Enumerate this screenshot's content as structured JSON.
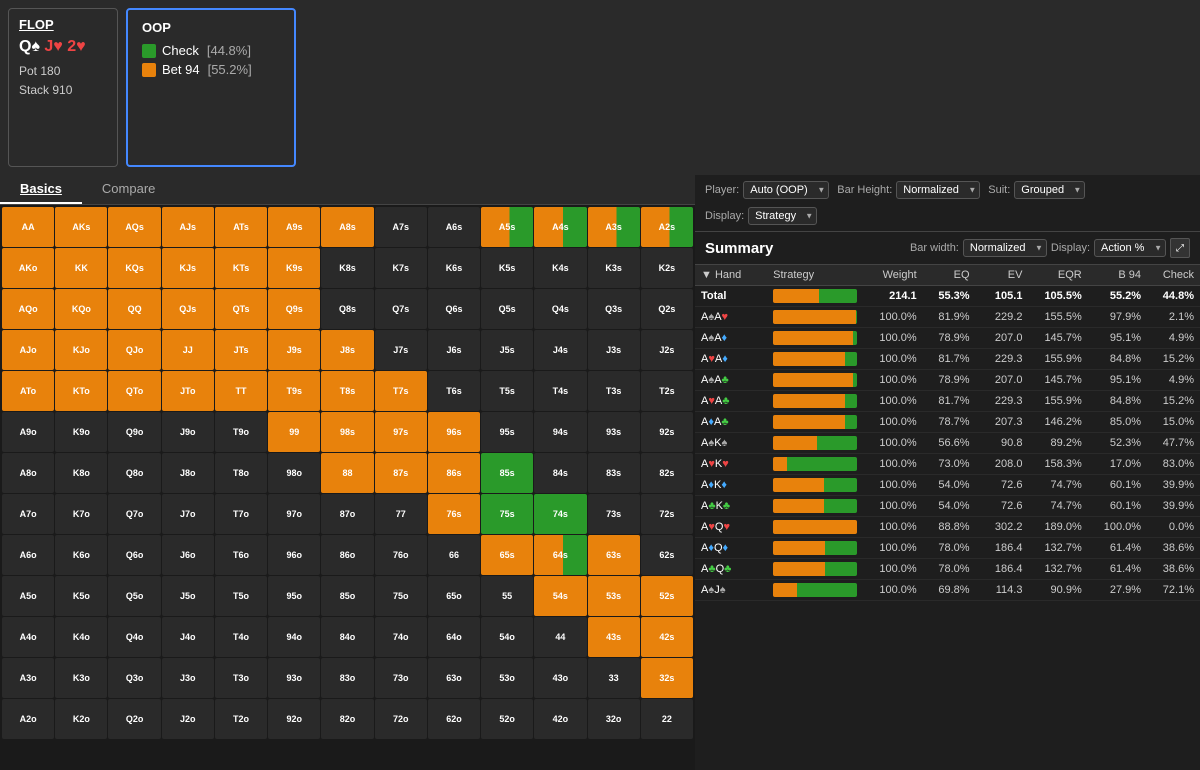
{
  "flop": {
    "title": "FLOP",
    "cards": "Q♠ J♥ 2♥",
    "pot": "Pot 180",
    "stack": "Stack 910"
  },
  "oop": {
    "title": "OOP",
    "actions": [
      {
        "label": "Check",
        "pct": "[44.8%]",
        "color": "#2a9a2a"
      },
      {
        "label": "Bet 94",
        "pct": "[55.2%]",
        "color": "#e8820c"
      }
    ]
  },
  "tabs": [
    {
      "label": "Basics",
      "active": true
    },
    {
      "label": "Compare",
      "active": false
    }
  ],
  "controls": {
    "player_label": "Player:",
    "player_value": "Auto (OOP)",
    "bar_height_label": "Bar Height:",
    "bar_height_value": "Normalized",
    "suit_label": "Suit:",
    "suit_value": "Grouped",
    "display_label": "Display:",
    "display_value": "Strategy",
    "bar_width_label": "Bar width:",
    "bar_width_value": "Normalized",
    "display2_label": "Display:",
    "display2_value": "Action %"
  },
  "summary": {
    "title": "Summary",
    "columns": [
      "Hand",
      "Strategy",
      "Weight",
      "EQ",
      "EV",
      "EQR",
      "B 94",
      "Check"
    ],
    "total": {
      "hand": "Total",
      "weight": "214.1",
      "eq": "55.3%",
      "ev": "105.1",
      "eqr": "105.5%",
      "b94": "55.2%",
      "check": "44.8%",
      "bar": [
        55,
        45
      ]
    },
    "rows": [
      {
        "hand": "A♠A♥",
        "hand_html": "A♠A♥",
        "weight": "100.0%",
        "eq": "81.9%",
        "ev": "229.2",
        "eqr": "155.5%",
        "b94": "97.9%",
        "check": "2.1%",
        "bar": [
          98,
          2
        ]
      },
      {
        "hand": "A♠A♦",
        "hand_html": "A♠A♦",
        "weight": "100.0%",
        "eq": "78.9%",
        "ev": "207.0",
        "eqr": "145.7%",
        "b94": "95.1%",
        "check": "4.9%",
        "bar": [
          95,
          5
        ]
      },
      {
        "hand": "A♥A♦",
        "hand_html": "A♥A♦",
        "weight": "100.0%",
        "eq": "81.7%",
        "ev": "229.3",
        "eqr": "155.9%",
        "b94": "84.8%",
        "check": "15.2%",
        "bar": [
          85,
          15
        ]
      },
      {
        "hand": "A♠A♣",
        "hand_html": "A♠A♣",
        "weight": "100.0%",
        "eq": "78.9%",
        "ev": "207.0",
        "eqr": "145.7%",
        "b94": "95.1%",
        "check": "4.9%",
        "bar": [
          95,
          5
        ]
      },
      {
        "hand": "A♥A♣",
        "hand_html": "A♥A♣",
        "weight": "100.0%",
        "eq": "81.7%",
        "ev": "229.3",
        "eqr": "155.9%",
        "b94": "84.8%",
        "check": "15.2%",
        "bar": [
          85,
          15
        ]
      },
      {
        "hand": "A♦A♣",
        "hand_html": "A♦A♣",
        "weight": "100.0%",
        "eq": "78.7%",
        "ev": "207.3",
        "eqr": "146.2%",
        "b94": "85.0%",
        "check": "15.0%",
        "bar": [
          85,
          15
        ]
      },
      {
        "hand": "A♠K♠",
        "hand_html": "A♠K♠",
        "weight": "100.0%",
        "eq": "56.6%",
        "ev": "90.8",
        "eqr": "89.2%",
        "b94": "52.3%",
        "check": "47.7%",
        "bar": [
          52,
          48
        ]
      },
      {
        "hand": "A♥K♥",
        "hand_html": "A♥K♥",
        "weight": "100.0%",
        "eq": "73.0%",
        "ev": "208.0",
        "eqr": "158.3%",
        "b94": "17.0%",
        "check": "83.0%",
        "bar": [
          17,
          83
        ]
      },
      {
        "hand": "A♦K♦",
        "hand_html": "A♦K♦",
        "weight": "100.0%",
        "eq": "54.0%",
        "ev": "72.6",
        "eqr": "74.7%",
        "b94": "60.1%",
        "check": "39.9%",
        "bar": [
          60,
          40
        ]
      },
      {
        "hand": "A♣K♣",
        "hand_html": "A♣K♣",
        "weight": "100.0%",
        "eq": "54.0%",
        "ev": "72.6",
        "eqr": "74.7%",
        "b94": "60.1%",
        "check": "39.9%",
        "bar": [
          60,
          40
        ]
      },
      {
        "hand": "A♥Q♥",
        "hand_html": "A♥Q♥",
        "weight": "100.0%",
        "eq": "88.8%",
        "ev": "302.2",
        "eqr": "189.0%",
        "b94": "100.0%",
        "check": "0.0%",
        "bar": [
          100,
          0
        ]
      },
      {
        "hand": "A♦Q♦",
        "hand_html": "A♦Q♦",
        "weight": "100.0%",
        "eq": "78.0%",
        "ev": "186.4",
        "eqr": "132.7%",
        "b94": "61.4%",
        "check": "38.6%",
        "bar": [
          61,
          39
        ]
      },
      {
        "hand": "A♣Q♣",
        "hand_html": "A♣Q♣",
        "weight": "100.0%",
        "eq": "78.0%",
        "ev": "186.4",
        "eqr": "132.7%",
        "b94": "61.4%",
        "check": "38.6%",
        "bar": [
          61,
          39
        ]
      },
      {
        "hand": "A♠J♠",
        "hand_html": "A♠J♠",
        "weight": "100.0%",
        "eq": "69.8%",
        "ev": "114.3",
        "eqr": "90.9%",
        "b94": "27.9%",
        "check": "72.1%",
        "bar": [
          28,
          72
        ]
      }
    ]
  },
  "grid": {
    "cells": [
      {
        "label": "AA",
        "type": "orange"
      },
      {
        "label": "AKs",
        "type": "orange"
      },
      {
        "label": "AQs",
        "type": "orange"
      },
      {
        "label": "AJs",
        "type": "orange"
      },
      {
        "label": "ATs",
        "type": "orange"
      },
      {
        "label": "A9s",
        "type": "orange"
      },
      {
        "label": "A8s",
        "type": "orange"
      },
      {
        "label": "A7s",
        "type": "dark"
      },
      {
        "label": "A6s",
        "type": "dark"
      },
      {
        "label": "A5s",
        "type": "mixed"
      },
      {
        "label": "A4s",
        "type": "mixed"
      },
      {
        "label": "A3s",
        "type": "mixed"
      },
      {
        "label": "A2s",
        "type": "mixed"
      },
      {
        "label": "AKo",
        "type": "orange"
      },
      {
        "label": "KK",
        "type": "orange"
      },
      {
        "label": "KQs",
        "type": "orange"
      },
      {
        "label": "KJs",
        "type": "orange"
      },
      {
        "label": "KTs",
        "type": "orange"
      },
      {
        "label": "K9s",
        "type": "orange"
      },
      {
        "label": "K8s",
        "type": "dark"
      },
      {
        "label": "K7s",
        "type": "dark"
      },
      {
        "label": "K6s",
        "type": "dark"
      },
      {
        "label": "K5s",
        "type": "dark"
      },
      {
        "label": "K4s",
        "type": "dark"
      },
      {
        "label": "K3s",
        "type": "dark"
      },
      {
        "label": "K2s",
        "type": "dark"
      },
      {
        "label": "AQo",
        "type": "orange"
      },
      {
        "label": "KQo",
        "type": "orange"
      },
      {
        "label": "QQ",
        "type": "orange"
      },
      {
        "label": "QJs",
        "type": "orange"
      },
      {
        "label": "QTs",
        "type": "orange"
      },
      {
        "label": "Q9s",
        "type": "orange"
      },
      {
        "label": "Q8s",
        "type": "dark"
      },
      {
        "label": "Q7s",
        "type": "dark"
      },
      {
        "label": "Q6s",
        "type": "dark"
      },
      {
        "label": "Q5s",
        "type": "dark"
      },
      {
        "label": "Q4s",
        "type": "dark"
      },
      {
        "label": "Q3s",
        "type": "dark"
      },
      {
        "label": "Q2s",
        "type": "dark"
      },
      {
        "label": "AJo",
        "type": "orange"
      },
      {
        "label": "KJo",
        "type": "orange"
      },
      {
        "label": "QJo",
        "type": "orange"
      },
      {
        "label": "JJ",
        "type": "orange"
      },
      {
        "label": "JTs",
        "type": "orange"
      },
      {
        "label": "J9s",
        "type": "orange"
      },
      {
        "label": "J8s",
        "type": "orange"
      },
      {
        "label": "J7s",
        "type": "dark"
      },
      {
        "label": "J6s",
        "type": "dark"
      },
      {
        "label": "J5s",
        "type": "dark"
      },
      {
        "label": "J4s",
        "type": "dark"
      },
      {
        "label": "J3s",
        "type": "dark"
      },
      {
        "label": "J2s",
        "type": "dark"
      },
      {
        "label": "ATo",
        "type": "orange"
      },
      {
        "label": "KTo",
        "type": "orange"
      },
      {
        "label": "QTo",
        "type": "orange"
      },
      {
        "label": "JTo",
        "type": "orange"
      },
      {
        "label": "TT",
        "type": "orange"
      },
      {
        "label": "T9s",
        "type": "orange"
      },
      {
        "label": "T8s",
        "type": "orange"
      },
      {
        "label": "T7s",
        "type": "orange"
      },
      {
        "label": "T6s",
        "type": "dark"
      },
      {
        "label": "T5s",
        "type": "dark"
      },
      {
        "label": "T4s",
        "type": "dark"
      },
      {
        "label": "T3s",
        "type": "dark"
      },
      {
        "label": "T2s",
        "type": "dark"
      },
      {
        "label": "A9o",
        "type": "dark"
      },
      {
        "label": "K9o",
        "type": "dark"
      },
      {
        "label": "Q9o",
        "type": "dark"
      },
      {
        "label": "J9o",
        "type": "dark"
      },
      {
        "label": "T9o",
        "type": "dark"
      },
      {
        "label": "99",
        "type": "orange"
      },
      {
        "label": "98s",
        "type": "orange"
      },
      {
        "label": "97s",
        "type": "orange"
      },
      {
        "label": "96s",
        "type": "orange"
      },
      {
        "label": "95s",
        "type": "dark"
      },
      {
        "label": "94s",
        "type": "dark"
      },
      {
        "label": "93s",
        "type": "dark"
      },
      {
        "label": "92s",
        "type": "dark"
      },
      {
        "label": "A8o",
        "type": "dark"
      },
      {
        "label": "K8o",
        "type": "dark"
      },
      {
        "label": "Q8o",
        "type": "dark"
      },
      {
        "label": "J8o",
        "type": "dark"
      },
      {
        "label": "T8o",
        "type": "dark"
      },
      {
        "label": "98o",
        "type": "dark"
      },
      {
        "label": "88",
        "type": "orange"
      },
      {
        "label": "87s",
        "type": "orange"
      },
      {
        "label": "86s",
        "type": "orange"
      },
      {
        "label": "85s",
        "type": "green"
      },
      {
        "label": "84s",
        "type": "dark"
      },
      {
        "label": "83s",
        "type": "dark"
      },
      {
        "label": "82s",
        "type": "dark"
      },
      {
        "label": "A7o",
        "type": "dark"
      },
      {
        "label": "K7o",
        "type": "dark"
      },
      {
        "label": "Q7o",
        "type": "dark"
      },
      {
        "label": "J7o",
        "type": "dark"
      },
      {
        "label": "T7o",
        "type": "dark"
      },
      {
        "label": "97o",
        "type": "dark"
      },
      {
        "label": "87o",
        "type": "dark"
      },
      {
        "label": "77",
        "type": "dark"
      },
      {
        "label": "76s",
        "type": "orange"
      },
      {
        "label": "75s",
        "type": "green"
      },
      {
        "label": "74s",
        "type": "green"
      },
      {
        "label": "73s",
        "type": "dark"
      },
      {
        "label": "72s",
        "type": "dark"
      },
      {
        "label": "A6o",
        "type": "dark"
      },
      {
        "label": "K6o",
        "type": "dark"
      },
      {
        "label": "Q6o",
        "type": "dark"
      },
      {
        "label": "J6o",
        "type": "dark"
      },
      {
        "label": "T6o",
        "type": "dark"
      },
      {
        "label": "96o",
        "type": "dark"
      },
      {
        "label": "86o",
        "type": "dark"
      },
      {
        "label": "76o",
        "type": "dark"
      },
      {
        "label": "66",
        "type": "dark"
      },
      {
        "label": "65s",
        "type": "orange"
      },
      {
        "label": "64s",
        "type": "mixed"
      },
      {
        "label": "63s",
        "type": "orange"
      },
      {
        "label": "62s",
        "type": "dark"
      },
      {
        "label": "A5o",
        "type": "dark"
      },
      {
        "label": "K5o",
        "type": "dark"
      },
      {
        "label": "Q5o",
        "type": "dark"
      },
      {
        "label": "J5o",
        "type": "dark"
      },
      {
        "label": "T5o",
        "type": "dark"
      },
      {
        "label": "95o",
        "type": "dark"
      },
      {
        "label": "85o",
        "type": "dark"
      },
      {
        "label": "75o",
        "type": "dark"
      },
      {
        "label": "65o",
        "type": "dark"
      },
      {
        "label": "55",
        "type": "dark"
      },
      {
        "label": "54s",
        "type": "orange"
      },
      {
        "label": "53s",
        "type": "orange"
      },
      {
        "label": "52s",
        "type": "orange"
      },
      {
        "label": "A4o",
        "type": "dark"
      },
      {
        "label": "K4o",
        "type": "dark"
      },
      {
        "label": "Q4o",
        "type": "dark"
      },
      {
        "label": "J4o",
        "type": "dark"
      },
      {
        "label": "T4o",
        "type": "dark"
      },
      {
        "label": "94o",
        "type": "dark"
      },
      {
        "label": "84o",
        "type": "dark"
      },
      {
        "label": "74o",
        "type": "dark"
      },
      {
        "label": "64o",
        "type": "dark"
      },
      {
        "label": "54o",
        "type": "dark"
      },
      {
        "label": "44",
        "type": "dark"
      },
      {
        "label": "43s",
        "type": "orange"
      },
      {
        "label": "42s",
        "type": "orange"
      },
      {
        "label": "A3o",
        "type": "dark"
      },
      {
        "label": "K3o",
        "type": "dark"
      },
      {
        "label": "Q3o",
        "type": "dark"
      },
      {
        "label": "J3o",
        "type": "dark"
      },
      {
        "label": "T3o",
        "type": "dark"
      },
      {
        "label": "93o",
        "type": "dark"
      },
      {
        "label": "83o",
        "type": "dark"
      },
      {
        "label": "73o",
        "type": "dark"
      },
      {
        "label": "63o",
        "type": "dark"
      },
      {
        "label": "53o",
        "type": "dark"
      },
      {
        "label": "43o",
        "type": "dark"
      },
      {
        "label": "33",
        "type": "dark"
      },
      {
        "label": "32s",
        "type": "orange"
      },
      {
        "label": "A2o",
        "type": "dark"
      },
      {
        "label": "K2o",
        "type": "dark"
      },
      {
        "label": "Q2o",
        "type": "dark"
      },
      {
        "label": "J2o",
        "type": "dark"
      },
      {
        "label": "T2o",
        "type": "dark"
      },
      {
        "label": "92o",
        "type": "dark"
      },
      {
        "label": "82o",
        "type": "dark"
      },
      {
        "label": "72o",
        "type": "dark"
      },
      {
        "label": "62o",
        "type": "dark"
      },
      {
        "label": "52o",
        "type": "dark"
      },
      {
        "label": "42o",
        "type": "dark"
      },
      {
        "label": "32o",
        "type": "dark"
      },
      {
        "label": "22",
        "type": "dark"
      }
    ]
  }
}
